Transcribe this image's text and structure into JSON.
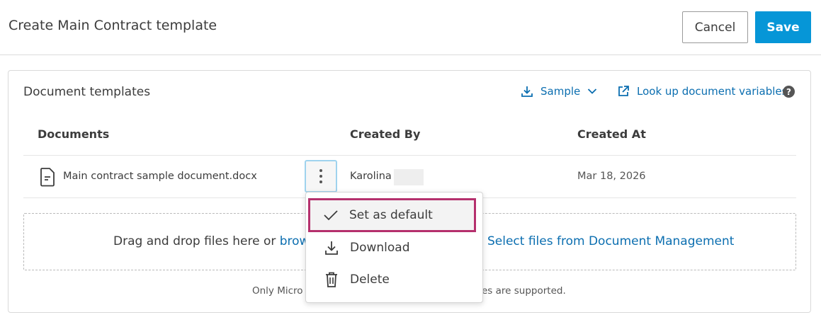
{
  "header": {
    "title": "Create Main Contract template",
    "cancel_label": "Cancel",
    "save_label": "Save"
  },
  "card": {
    "title": "Document templates",
    "sample_label": "Sample",
    "lookup_label": "Look up document variables",
    "help_icon": "?"
  },
  "table": {
    "columns": [
      "Documents",
      "Created By",
      "Created At"
    ],
    "rows": [
      {
        "document": "Main contract sample document.docx",
        "created_by": "Karolina",
        "created_at": "Mar 18, 2026"
      }
    ]
  },
  "dropzone": {
    "text": "Drag and drop files here or ",
    "browse_fragment": "brows",
    "select_link": "Select files from Document Management"
  },
  "footnote": {
    "left": "Only Micro",
    "right": "es are supported."
  },
  "menu": {
    "items": [
      {
        "label": "Set as default",
        "icon": "checkmark-icon"
      },
      {
        "label": "Download",
        "icon": "download-icon"
      },
      {
        "label": "Delete",
        "icon": "trash-icon"
      }
    ]
  },
  "colors": {
    "accent": "#0696d7",
    "link": "#0b6eb0",
    "highlight_border": "#b5306d"
  }
}
